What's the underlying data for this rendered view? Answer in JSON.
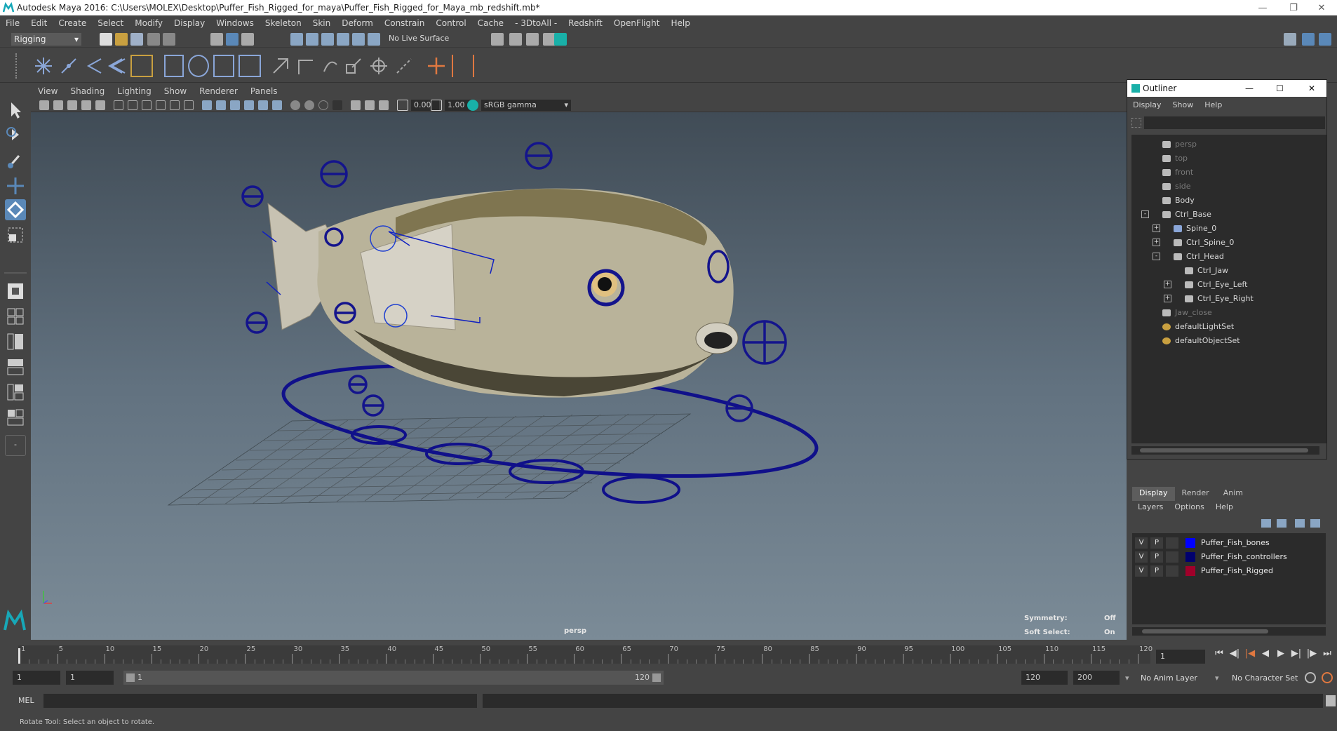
{
  "window": {
    "title": "Autodesk Maya 2016: C:\\Users\\MOLEX\\Desktop\\Puffer_Fish_Rigged_for_maya\\Puffer_Fish_Rigged_for_Maya_mb_redshift.mb*"
  },
  "menubar": [
    "File",
    "Edit",
    "Create",
    "Select",
    "Modify",
    "Display",
    "Windows",
    "Skeleton",
    "Skin",
    "Deform",
    "Constrain",
    "Control",
    "Cache",
    "- 3DtoAll -",
    "Redshift",
    "OpenFlight",
    "Help"
  ],
  "statusline": {
    "mode": "Rigging",
    "live_surface": "No Live Surface"
  },
  "viewport": {
    "menu": [
      "View",
      "Shading",
      "Lighting",
      "Show",
      "Renderer",
      "Panels"
    ],
    "exposure": "0.00",
    "gamma": "1.00",
    "color_space": "sRGB gamma",
    "camera_label": "persp",
    "hud": {
      "symmetry_label": "Symmetry:",
      "symmetry_value": "Off",
      "soft_select_label": "Soft Select:",
      "soft_select_value": "On"
    }
  },
  "outliner": {
    "title": "Outliner",
    "menu": [
      "Display",
      "Show",
      "Help"
    ],
    "items": [
      {
        "label": "persp",
        "dim": true,
        "indent": 0,
        "icon": "camera"
      },
      {
        "label": "top",
        "dim": true,
        "indent": 0,
        "icon": "camera"
      },
      {
        "label": "front",
        "dim": true,
        "indent": 0,
        "icon": "camera"
      },
      {
        "label": "side",
        "dim": true,
        "indent": 0,
        "icon": "camera"
      },
      {
        "label": "Body",
        "dim": false,
        "indent": 0,
        "icon": "transform"
      },
      {
        "label": "Ctrl_Base",
        "dim": false,
        "indent": 0,
        "icon": "transform",
        "expander": "-"
      },
      {
        "label": "Spine_0",
        "dim": false,
        "indent": 1,
        "icon": "joint",
        "expander": "+"
      },
      {
        "label": "Ctrl_Spine_0",
        "dim": false,
        "indent": 1,
        "icon": "transform",
        "expander": "+"
      },
      {
        "label": "Ctrl_Head",
        "dim": false,
        "indent": 1,
        "icon": "transform",
        "expander": "-"
      },
      {
        "label": "Ctrl_Jaw",
        "dim": false,
        "indent": 2,
        "icon": "transform"
      },
      {
        "label": "Ctrl_Eye_Left",
        "dim": false,
        "indent": 2,
        "icon": "transform",
        "expander": "+"
      },
      {
        "label": "Ctrl_Eye_Right",
        "dim": false,
        "indent": 2,
        "icon": "transform",
        "expander": "+"
      },
      {
        "label": "Jaw_close",
        "dim": true,
        "indent": 0,
        "icon": "transform"
      },
      {
        "label": "defaultLightSet",
        "dim": false,
        "indent": 0,
        "icon": "set"
      },
      {
        "label": "defaultObjectSet",
        "dim": false,
        "indent": 0,
        "icon": "set"
      }
    ]
  },
  "layers": {
    "tabs": [
      "Display",
      "Render",
      "Anim"
    ],
    "active_tab": "Display",
    "menu": [
      "Layers",
      "Options",
      "Help"
    ],
    "rows": [
      {
        "v": "V",
        "p": "P",
        "color": "#0000ff",
        "name": "Puffer_Fish_bones"
      },
      {
        "v": "V",
        "p": "P",
        "color": "#00006e",
        "name": "Puffer_Fish_controllers"
      },
      {
        "v": "V",
        "p": "P",
        "color": "#a0002a",
        "name": "Puffer_Fish_Rigged"
      }
    ]
  },
  "timeline": {
    "ticks": [
      "1",
      "5",
      "10",
      "15",
      "20",
      "25",
      "30",
      "35",
      "40",
      "45",
      "50",
      "55",
      "60",
      "65",
      "70",
      "75",
      "80",
      "85",
      "90",
      "95",
      "100",
      "105",
      "110",
      "115",
      "120"
    ],
    "current_frame": "1"
  },
  "range": {
    "start": "1",
    "playback_start": "1",
    "slider_start": "1",
    "slider_end": "120",
    "playback_end": "120",
    "end": "200",
    "anim_layer": "No Anim Layer",
    "character_set": "No Character Set"
  },
  "cmdline": {
    "label": "MEL"
  },
  "helpline": {
    "text": "Rotate Tool: Select an object to rotate."
  }
}
